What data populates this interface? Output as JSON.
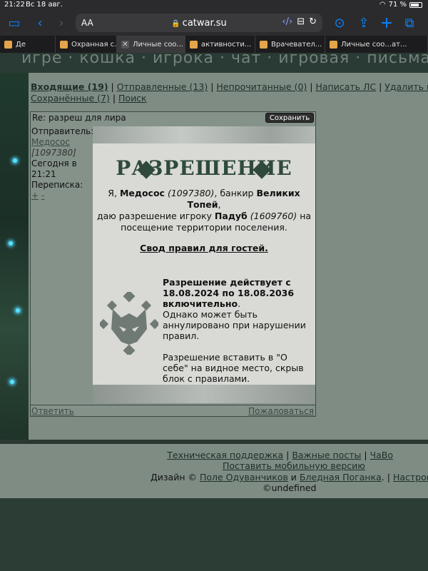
{
  "statusbar": {
    "time": "21:22",
    "date": "Вс 18 авг.",
    "battery": "71 %"
  },
  "browser": {
    "text_size_label": "AA",
    "url": "catwar.su",
    "tabs": [
      {
        "label": "Де",
        "icon": "cat-favicon"
      },
      {
        "label": "Охранная с...",
        "icon": "cat-favicon"
      },
      {
        "label": "Личные соо...",
        "icon": "close-icon",
        "active": true
      },
      {
        "label": "активности...",
        "icon": "cat-favicon"
      },
      {
        "label": "Врачевател...",
        "icon": "cat-favicon"
      },
      {
        "label": "Личные соо...ат...",
        "icon": "cat-favicon"
      }
    ]
  },
  "banner": {
    "text": "игре · кошка · игрока · чат · игровая · письма · сло"
  },
  "mailnav": {
    "inbox": "Входящие (19)",
    "sent": "Отправленные (13)",
    "unread": "Непрочитанные (0)",
    "write": "Написать ЛС",
    "delete": "Удалить проч",
    "saved": "Сохранённые (7)",
    "search": "Поиск",
    "sep": "|"
  },
  "message": {
    "subject": "Re: разреш для лира",
    "save_label": "Сохранить",
    "sender_label": "Отправитель:",
    "sender_name": "Медосос",
    "sender_id": "[1097380]",
    "date_line1": "Сегодня в",
    "date_line2": "21:21",
    "thread_label": "Переписка:",
    "thread_plus": "+",
    "thread_minus": "-",
    "reply_label": "Ответить",
    "report_label": "Пожаловаться"
  },
  "permit": {
    "title": "РАЗРЕШЕНИЕ",
    "line_1_pre": "Я, ",
    "line_1_name": "Медосос",
    "line_1_id": "(1097380)",
    "line_1_mid": ", банкир ",
    "line_1_clan": "Великих Топей",
    "line_1_end": ",",
    "line_2_pre": "даю разрешение игроку ",
    "line_2_name": "Падуб",
    "line_2_id": "(1609760)",
    "line_2_end": " на",
    "line_3": "посещение территории поселения.",
    "rules_link": "Свод правил для гостей.",
    "valid_bold": "Разрешение действует с 18.08.2024 по 18.08.2036 включительно",
    "valid_dot": ".",
    "valid_note": "Однако может быть аннулировано при нарушении правил.",
    "insert_note": "Разрешение вставить в \"О себе\" на видное место, скрыв блок с правилами."
  },
  "footer": {
    "support": "Техническая поддержка",
    "important": "Важные посты",
    "faq": "ЧаВо",
    "mobile": "Поставить мобильную версию",
    "design_label": "Дизайн ©",
    "design_a": "Поле Одуванчиков",
    "and": "и",
    "design_b": "Бледная Поганка",
    "settings": "Настройки",
    "sep": "|",
    "copyright": "©undefined"
  },
  "colors": {
    "page_bg": "#7e8c84",
    "permit_bg": "#d9d9d5",
    "permit_title": "#2f4a3d",
    "accent_blue": "#0a84ff"
  }
}
